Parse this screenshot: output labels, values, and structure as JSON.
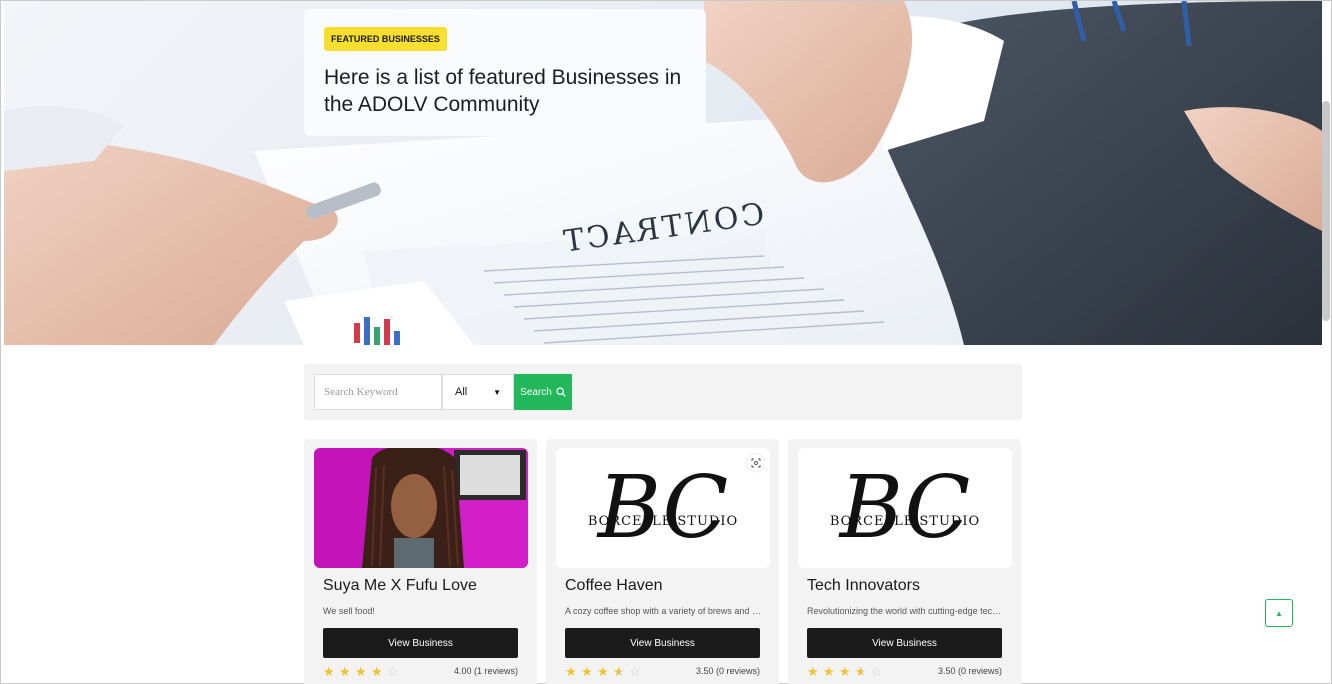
{
  "hero": {
    "badge": "FEATURED BUSINESSES",
    "title": "Here is a list of featured Businesses in the ADOLV Community",
    "image_icon": "handshake-contract-photo"
  },
  "search": {
    "placeholder": "Search Keyword",
    "category_value": "All",
    "button_label": "Search",
    "button_icon": "search-icon"
  },
  "businesses": [
    {
      "name": "Suya Me X Fufu Love",
      "description": "We sell food!",
      "button_label": "View Business",
      "rating": 4.0,
      "rating_text": "4.00 (1 reviews)",
      "image": "person-with-braids-photo"
    },
    {
      "name": "Coffee Haven",
      "description": "A cozy coffee shop with a variety of brews and desserts",
      "button_label": "View Business",
      "rating": 3.5,
      "rating_text": "3.50 (0 reviews)",
      "image": "borcelle-studio-logo",
      "logo_text": "BORCELLE STUDIO",
      "logo_letters": "BC"
    },
    {
      "name": "Tech Innovators",
      "description": "Revolutionizing the world with cutting-edge technology",
      "button_label": "View Business",
      "rating": 3.5,
      "rating_text": "3.50 (0 reviews)",
      "image": "borcelle-studio-logo",
      "logo_text": "BORCELLE STUDIO",
      "logo_letters": "BC"
    }
  ],
  "colors": {
    "accent": "#22b75a",
    "badge": "#f7df2f",
    "button_dark": "#1b1b1b",
    "star": "#f2c230"
  }
}
